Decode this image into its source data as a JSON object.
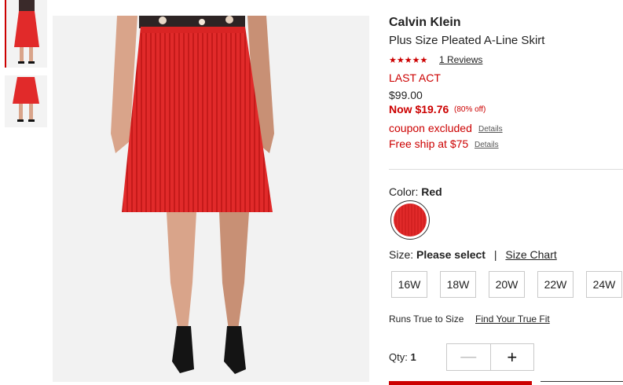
{
  "brand": "Calvin Klein",
  "product_name": "Plus Size Pleated A-Line Skirt",
  "rating": {
    "stars": "★★★★★",
    "value": 5,
    "reviews_label": "1 Reviews"
  },
  "promo_label": "LAST ACT",
  "price": {
    "original": "$99.00",
    "now": "Now $19.76",
    "discount": "(80% off)"
  },
  "coupon": {
    "text": "coupon excluded",
    "details_label": "Details"
  },
  "shipping": {
    "text": "Free ship at $75",
    "details_label": "Details"
  },
  "color": {
    "label": "Color:",
    "selected": "Red",
    "swatch_hex": "#e12a2a"
  },
  "size": {
    "label": "Size:",
    "selected": "Please select",
    "separator": "|",
    "chart_label": "Size Chart",
    "options": [
      "16W",
      "18W",
      "20W",
      "22W",
      "24W"
    ]
  },
  "fit": {
    "text": "Runs True to Size",
    "link_label": "Find Your True Fit"
  },
  "quantity": {
    "label": "Qty:",
    "value": "1",
    "minus": "—",
    "plus": "+"
  },
  "colors": {
    "accent": "#cc0000",
    "text": "#222222",
    "border": "#c9c9c9"
  }
}
